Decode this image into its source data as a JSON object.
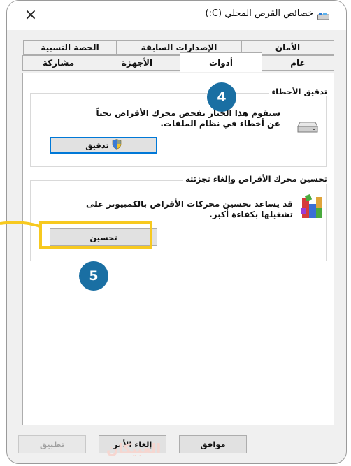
{
  "window": {
    "title": "خصائص القرص المحلي (C:)",
    "close_symbol": "×"
  },
  "tabs": {
    "row_back": [
      "الحصة النسبية",
      "الإصدارات السابقة",
      "الأمان"
    ],
    "row_front": [
      "مشاركة",
      "الأجهزة",
      "أدوات",
      "عام"
    ],
    "active": "أدوات"
  },
  "error_checking": {
    "title": "تدقيق الأخطاء",
    "description_line1": "سيقوم هذا الخيار بفحص محرك الأقراص بحثاً",
    "description_line2": "عن أخطاء في نظام الملفات.",
    "button_label": "تدقيق"
  },
  "optimize": {
    "title": "تحسين محرك الأقراص وإلغاء تجزئته",
    "description_line1": "قد يساعد تحسين محركات الأقراص بالكمبيوتر على",
    "description_line2": "تشغيلها بكفاءة أكبر.",
    "button_label": "تحسين"
  },
  "footer": {
    "ok_label": "موافق",
    "cancel_label": "إلغاء الأمر",
    "apply_label": "تطبيق"
  },
  "annotations": {
    "badge_tab": "4",
    "badge_optimize": "5",
    "highlight_color": "#f7c91f",
    "badge_color": "#1a6fa3"
  },
  "watermark": "العبيكان"
}
